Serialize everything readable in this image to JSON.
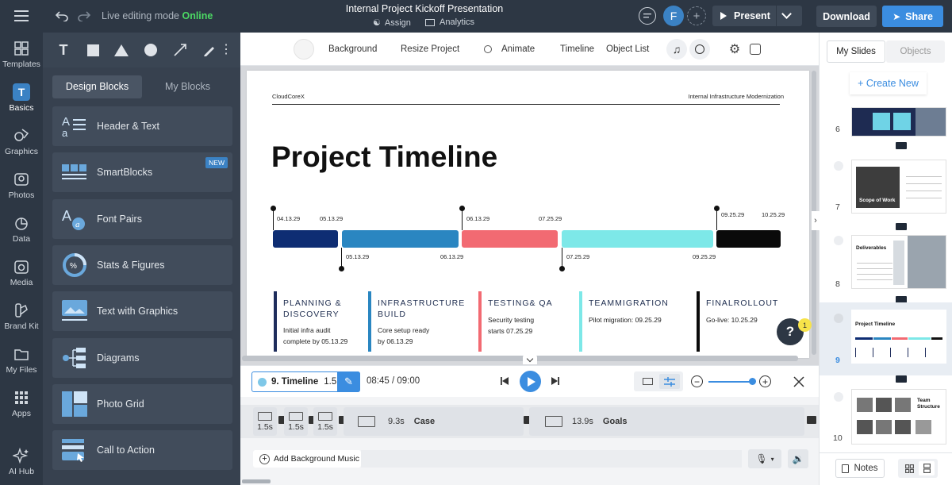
{
  "topbar": {
    "editing_mode": "Live editing mode",
    "status": "Online",
    "doc_title": "Internal Project Kickoff Presentation",
    "assign_label": "Assign",
    "analytics_label": "Analytics",
    "avatar_initial": "F",
    "present_label": "Present",
    "download_label": "Download",
    "share_label": "Share"
  },
  "rail": {
    "items": [
      {
        "label": "Templates",
        "icon": "templates-icon"
      },
      {
        "label": "Basics",
        "icon": "basics-icon"
      },
      {
        "label": "Graphics",
        "icon": "graphics-icon"
      },
      {
        "label": "Photos",
        "icon": "photos-icon"
      },
      {
        "label": "Data",
        "icon": "data-icon"
      },
      {
        "label": "Media",
        "icon": "media-icon"
      },
      {
        "label": "Brand Kit",
        "icon": "brand-kit-icon"
      },
      {
        "label": "My Files",
        "icon": "folder-icon"
      },
      {
        "label": "Apps",
        "icon": "apps-icon"
      },
      {
        "label": "AI Hub",
        "icon": "ai-hub-icon"
      }
    ]
  },
  "panel": {
    "tab_design": "Design Blocks",
    "tab_my": "My Blocks",
    "new_badge": "NEW",
    "blocks": [
      {
        "label": "Header & Text"
      },
      {
        "label": "SmartBlocks"
      },
      {
        "label": "Font Pairs"
      },
      {
        "label": "Stats & Figures"
      },
      {
        "label": "Text with Graphics"
      },
      {
        "label": "Diagrams"
      },
      {
        "label": "Photo Grid"
      },
      {
        "label": "Call to Action"
      }
    ]
  },
  "toolbar": {
    "background": "Background",
    "resize": "Resize Project",
    "animate": "Animate",
    "timeline": "Timeline",
    "object_list": "Object List"
  },
  "slide": {
    "brand": "CloudCoreX",
    "header_right": "Internal Infrastructure Modernization",
    "title": "Project Timeline",
    "top_dates": [
      "04.13.29",
      "05.13.29",
      "06.13.29",
      "07.25.29",
      "09.25.29",
      "10.25.29"
    ],
    "bottom_dates": [
      "05.13.29",
      "06.13.29",
      "07.25.29",
      "09.25.29"
    ],
    "segment_colors": [
      "#0e2d73",
      "#2a86c1",
      "#f26a72",
      "#7de8e8",
      "#0a0a0a"
    ],
    "cards": [
      {
        "title1": "PLANNING &",
        "title2": "DISCOVERY",
        "sub1": "Initial infra audit",
        "sub2": "complete by 05.13.29",
        "color": "#1e2d5c"
      },
      {
        "title1": "INFRASTRUCTURE",
        "title2": "BUILD",
        "sub1": "Core setup ready",
        "sub2": "by 06.13.29",
        "color": "#2a86c1"
      },
      {
        "title1": "TESTING& QA",
        "title2": "",
        "sub1": "Security testing",
        "sub2": "starts 07.25.29",
        "color": "#f26a72"
      },
      {
        "title1": "TEAMMIGRATION",
        "title2": "",
        "sub1": "Pilot migration: 09.25.29",
        "sub2": "",
        "color": "#7de8e8"
      },
      {
        "title1": "FINALROLLOUT",
        "title2": "",
        "sub1": "Go-live: 10.25.29",
        "sub2": "",
        "color": "#0a0a0a"
      }
    ],
    "help_label": "?",
    "help_badge": "1"
  },
  "controls": {
    "slide_label": "9. Timeline",
    "slide_duration": "1.5 s",
    "time": "08:45 / 09:00"
  },
  "timeline": {
    "small_clips": [
      "1.5s",
      "1.5s",
      "1.5s"
    ],
    "clip1_time": "9.3s",
    "clip1_label": "Case",
    "clip2_time": "13.9s",
    "clip2_label": "Goals",
    "music_label": "Add Background Music"
  },
  "right": {
    "tab_slides": "My Slides",
    "tab_objects": "Objects",
    "create_new": "+ Create New",
    "slide_numbers": [
      "6",
      "7",
      "8",
      "9",
      "10"
    ],
    "thumb7_title": "Scope of Work",
    "thumb8_title": "Deliverables",
    "thumb9_title": "Project Timeline",
    "thumb10_title1": "Team",
    "thumb10_title2": "Structure",
    "notes_label": "Notes"
  }
}
